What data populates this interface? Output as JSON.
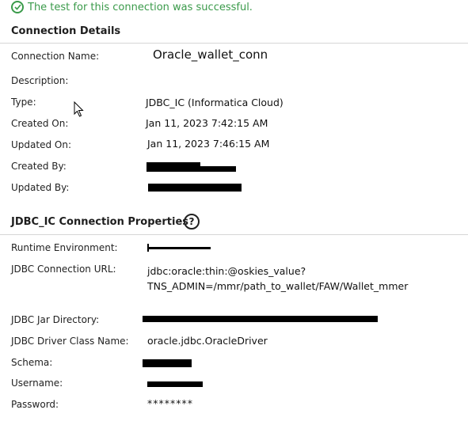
{
  "status": {
    "success_text": "The test for this connection was successful."
  },
  "details": {
    "title": "Connection Details",
    "connection_name_label": "Connection Name:",
    "connection_name": "Oracle_wallet_conn",
    "description_label": "Description:",
    "type_label": "Type:",
    "type_value": "JDBC_IC (Informatica Cloud)",
    "created_on_label": "Created On:",
    "created_on": "Jan 11, 2023 7:42:15 AM",
    "updated_on_label": "Updated On:",
    "updated_on": "Jan 11, 2023 7:46:15 AM",
    "created_by_label": "Created By:",
    "updated_by_label": "Updated By:"
  },
  "properties": {
    "title": "JDBC_IC Connection Properties",
    "help_glyph": "?",
    "runtime_label": "Runtime Environment:",
    "url_label": "JDBC Connection URL:",
    "url_line1": "jdbc:oracle:thin:@oskies_value?",
    "url_line2": "TNS_ADMIN=/mmr/path_to_wallet/FAW/Wallet_mmer",
    "jar_dir_label": "JDBC Jar Directory:",
    "driver_label": "JDBC Driver Class Name:",
    "driver_value": "oracle.jdbc.OracleDriver",
    "schema_label": "Schema:",
    "username_label": "Username:",
    "password_label": "Password:",
    "password_value": "********"
  },
  "colors": {
    "success": "#3a9a4a",
    "divider": "#d6d6d6",
    "redaction": "#000000"
  },
  "icons": {
    "success": "check-circle-icon",
    "help": "help-circle-icon",
    "cursor": "mouse-pointer-icon"
  }
}
